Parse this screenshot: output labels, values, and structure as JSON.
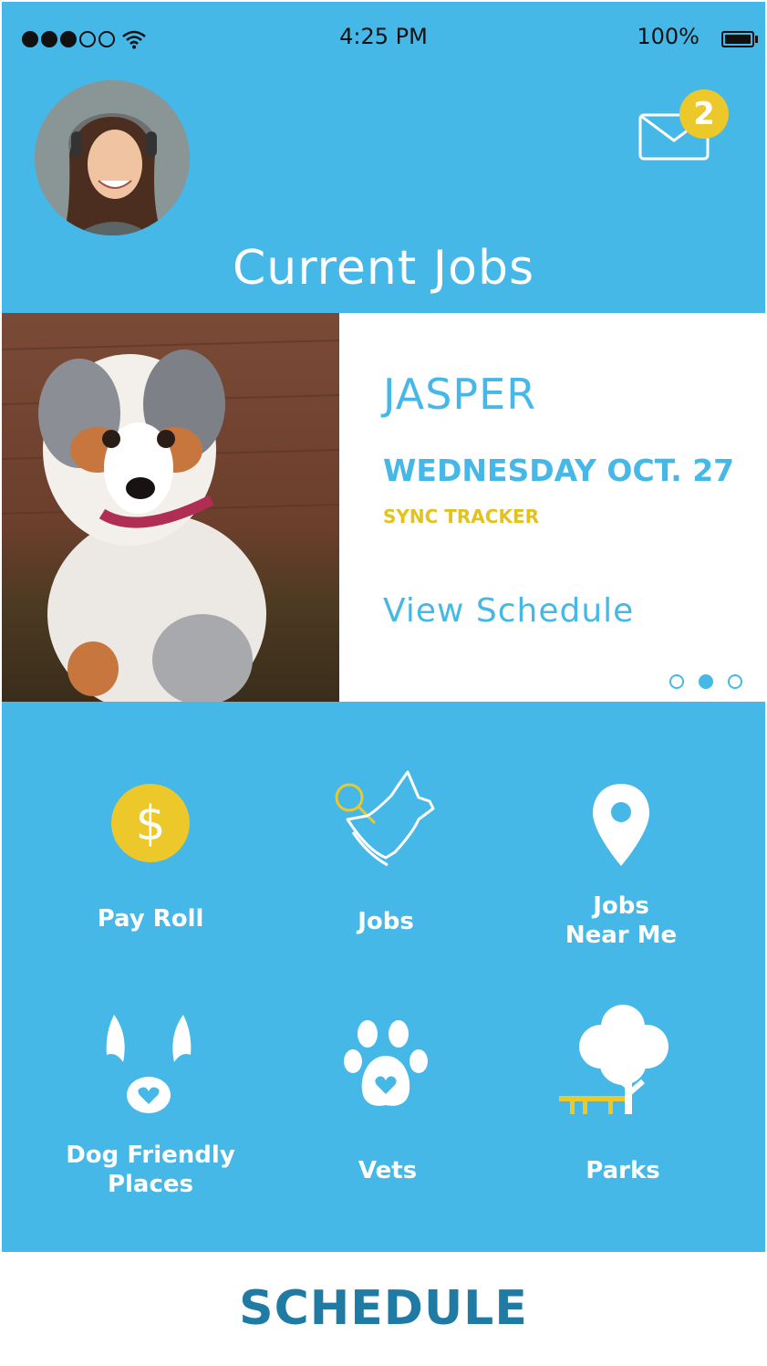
{
  "status_bar": {
    "time": "4:25 PM",
    "battery": "100%"
  },
  "header": {
    "title": "Current Jobs",
    "unread_count": "2"
  },
  "job_card": {
    "dog_name": "JASPER",
    "date": "WEDNESDAY OCT. 27",
    "sync_label": "SYNC TRACKER",
    "view_label": "View Schedule",
    "pager": {
      "total": 3,
      "active_index": 1
    }
  },
  "grid": [
    {
      "label_lines": [
        "Pay Roll"
      ],
      "icon": "dollar-coin-icon"
    },
    {
      "label_lines": [
        "Jobs"
      ],
      "icon": "dog-search-icon"
    },
    {
      "label_lines": [
        "Jobs",
        "Near Me"
      ],
      "icon": "map-pin-icon"
    },
    {
      "label_lines": [
        "Dog Friendly",
        "Places"
      ],
      "icon": "dog-ears-heart-icon"
    },
    {
      "label_lines": [
        "Vets"
      ],
      "icon": "paw-heart-icon"
    },
    {
      "label_lines": [
        "Parks"
      ],
      "icon": "tree-bench-icon"
    }
  ],
  "bottom_bar": {
    "label": "SCHEDULE"
  },
  "colors": {
    "primary": "#45b8e8",
    "accent": "#ecc82a",
    "dark_text": "#1f7ba3"
  }
}
